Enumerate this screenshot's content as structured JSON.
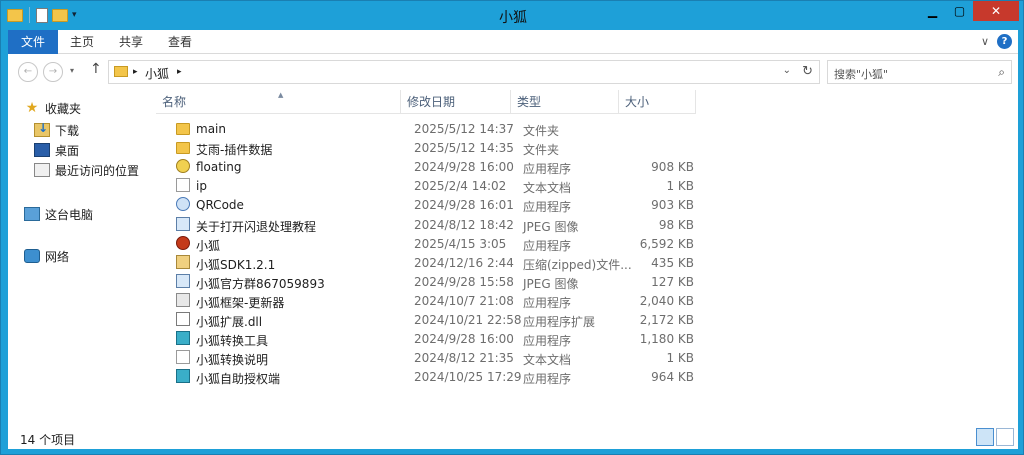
{
  "window": {
    "title": "小狐",
    "min_glyph": "▁",
    "max_glyph": "▢",
    "close_glyph": "✕"
  },
  "ribbon": {
    "tabs": [
      {
        "label": "文件"
      },
      {
        "label": "主页"
      },
      {
        "label": "共享"
      },
      {
        "label": "查看"
      }
    ],
    "expand_glyph": "∨",
    "help_glyph": "?"
  },
  "address": {
    "back_glyph": "←",
    "forward_glyph": "→",
    "up_glyph": "↑",
    "crumb_arrow": "▸",
    "path": "小狐",
    "dropdown_glyph": "⌄",
    "refresh_glyph": "↻",
    "search_placeholder": "搜索\"小狐\"",
    "search_glyph": "⌕"
  },
  "nav": {
    "items": [
      {
        "label": "收藏夹",
        "icon": "star-icon"
      },
      {
        "label": "下载",
        "icon": "downloads-icon"
      },
      {
        "label": "桌面",
        "icon": "desktop-icon"
      },
      {
        "label": "最近访问的位置",
        "icon": "recent-places-icon"
      },
      {
        "label": "这台电脑",
        "icon": "computer-icon"
      },
      {
        "label": "网络",
        "icon": "network-icon"
      }
    ]
  },
  "columns": {
    "name": "名称",
    "date": "修改日期",
    "type": "类型",
    "size": "大小",
    "sort_glyph": "▲"
  },
  "files": [
    {
      "name": "main",
      "date": "2025/5/12 14:37",
      "type": "文件夹",
      "size": "",
      "icon": "folder-icon"
    },
    {
      "name": "艾雨-插件数据",
      "date": "2025/5/12 14:35",
      "type": "文件夹",
      "size": "",
      "icon": "folder-icon"
    },
    {
      "name": "floating",
      "date": "2024/9/28 16:00",
      "type": "应用程序",
      "size": "908 KB",
      "icon": "app-icon"
    },
    {
      "name": "ip",
      "date": "2025/2/4 14:02",
      "type": "文本文档",
      "size": "1 KB",
      "icon": "text-file-icon"
    },
    {
      "name": "QRCode",
      "date": "2024/9/28 16:01",
      "type": "应用程序",
      "size": "903 KB",
      "icon": "app-icon"
    },
    {
      "name": "关于打开闪退处理教程",
      "date": "2024/8/12 18:42",
      "type": "JPEG 图像",
      "size": "98 KB",
      "icon": "image-icon"
    },
    {
      "name": "小狐",
      "date": "2025/4/15 3:05",
      "type": "应用程序",
      "size": "6,592 KB",
      "icon": "fox-app-icon"
    },
    {
      "name": "小狐SDK1.2.1",
      "date": "2024/12/16 2:44",
      "type": "压缩(zipped)文件...",
      "size": "435 KB",
      "icon": "zip-icon"
    },
    {
      "name": "小狐官方群867059893",
      "date": "2024/9/28 15:58",
      "type": "JPEG 图像",
      "size": "127 KB",
      "icon": "image-icon"
    },
    {
      "name": "小狐框架-更新器",
      "date": "2024/10/7 21:08",
      "type": "应用程序",
      "size": "2,040 KB",
      "icon": "app-icon"
    },
    {
      "name": "小狐扩展.dll",
      "date": "2024/10/21 22:58",
      "type": "应用程序扩展",
      "size": "2,172 KB",
      "icon": "dll-icon"
    },
    {
      "name": "小狐转换工具",
      "date": "2024/9/28 16:00",
      "type": "应用程序",
      "size": "1,180 KB",
      "icon": "app-icon"
    },
    {
      "name": "小狐转换说明",
      "date": "2024/8/12 21:35",
      "type": "文本文档",
      "size": "1 KB",
      "icon": "text-file-icon"
    },
    {
      "name": "小狐自助授权端",
      "date": "2024/10/25 17:29",
      "type": "应用程序",
      "size": "964 KB",
      "icon": "app-icon"
    }
  ],
  "status": {
    "count": "14 个项目"
  },
  "colors": {
    "titlebar": "#1ea0d8",
    "file_tab": "#1f6fc5",
    "close": "#c7392c"
  }
}
